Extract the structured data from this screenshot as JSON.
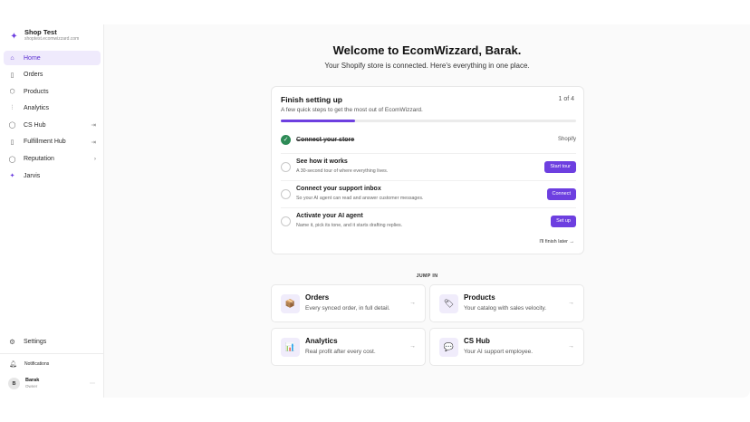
{
  "store": {
    "name": "Shop Test",
    "domain": "shoptest.ecomwizzard.com"
  },
  "nav": {
    "items": [
      {
        "label": "Home",
        "icon": "home-icon",
        "active": true
      },
      {
        "label": "Orders",
        "icon": "document-icon"
      },
      {
        "label": "Products",
        "icon": "box-icon"
      },
      {
        "label": "Analytics",
        "icon": "chart-icon"
      },
      {
        "label": "CS Hub",
        "icon": "chat-icon",
        "trail": "exit-icon"
      },
      {
        "label": "Fulfillment Hub",
        "icon": "document-icon",
        "trail": "exit-icon"
      },
      {
        "label": "Reputation",
        "icon": "chat-icon",
        "trail": "chevron-right-icon"
      },
      {
        "label": "Jarvis",
        "icon": "sparkle-icon"
      }
    ],
    "settings": "Settings",
    "notifications": "Notifications"
  },
  "user": {
    "initial": "B",
    "name": "Barak",
    "role": "Owner"
  },
  "main": {
    "title": "Welcome to EcomWizzard, Barak.",
    "subtitle": "Your Shopify store is connected. Here's everything in one place."
  },
  "setup": {
    "title": "Finish setting up",
    "count": "1 of 4",
    "description": "A few quick steps to get the most out of EcomWizzard.",
    "progress": 0.25,
    "steps": [
      {
        "title": "Connect your store",
        "done": true,
        "right_text": "Shopify"
      },
      {
        "title": "See how it works",
        "desc": "A 30-second tour of where everything lives.",
        "button": "Start tour"
      },
      {
        "title": "Connect your support inbox",
        "desc": "So your AI agent can read and answer customer messages.",
        "button": "Connect"
      },
      {
        "title": "Activate your AI agent",
        "desc": "Name it, pick its tone, and it starts drafting replies.",
        "button": "Set up"
      }
    ],
    "later": "I'll finish later →"
  },
  "jump": {
    "heading": "JUMP IN",
    "tiles": [
      {
        "title": "Orders",
        "desc": "Every synced order, in full detail.",
        "icon": "📦"
      },
      {
        "title": "Products",
        "desc": "Your catalog with sales velocity.",
        "icon": "🏷"
      },
      {
        "title": "Analytics",
        "desc": "Real profit after every cost.",
        "icon": "📊"
      },
      {
        "title": "CS Hub",
        "desc": "Your AI support employee.",
        "icon": "💬"
      }
    ],
    "arrow": "→"
  },
  "colors": {
    "accent": "#6d3fe0",
    "done": "#2e8b57",
    "active_bg": "#efeafc"
  }
}
